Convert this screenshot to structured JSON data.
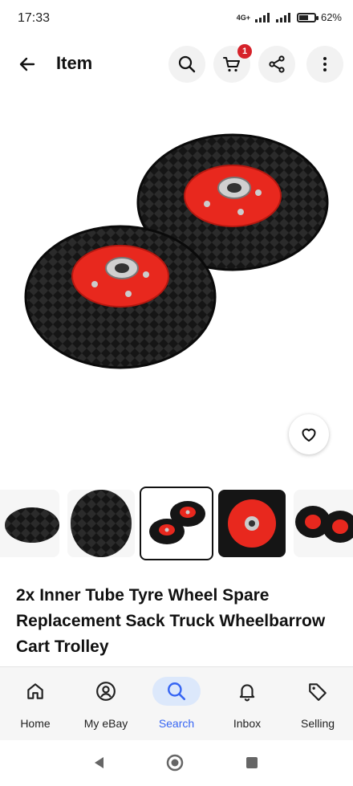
{
  "status_bar": {
    "time": "17:33",
    "battery": "62%",
    "battery_level": 0.62,
    "network": "4G+"
  },
  "header": {
    "title": "Item",
    "cart_count": "1"
  },
  "product": {
    "title": "2x Inner Tube Tyre Wheel Spare Replacement Sack Truck Wheelbarrow Cart Trolley"
  },
  "gallery": {
    "selected_index": 2,
    "thumbnails": [
      {
        "name": "single-tyre-side"
      },
      {
        "name": "tread-closeup"
      },
      {
        "name": "two-wheels"
      },
      {
        "name": "red-rim-front"
      },
      {
        "name": "two-wheels-alt"
      }
    ]
  },
  "bottom_nav": {
    "items": [
      {
        "label": "Home",
        "icon": "home-icon",
        "active": false
      },
      {
        "label": "My eBay",
        "icon": "person-icon",
        "active": false
      },
      {
        "label": "Search",
        "icon": "search-icon",
        "active": true
      },
      {
        "label": "Inbox",
        "icon": "bell-icon",
        "active": false
      },
      {
        "label": "Selling",
        "icon": "tag-icon",
        "active": false
      }
    ]
  },
  "colors": {
    "accent": "#3665f3",
    "badge": "#d6222a",
    "rim": "#e8281e",
    "tyre": "#111111"
  }
}
